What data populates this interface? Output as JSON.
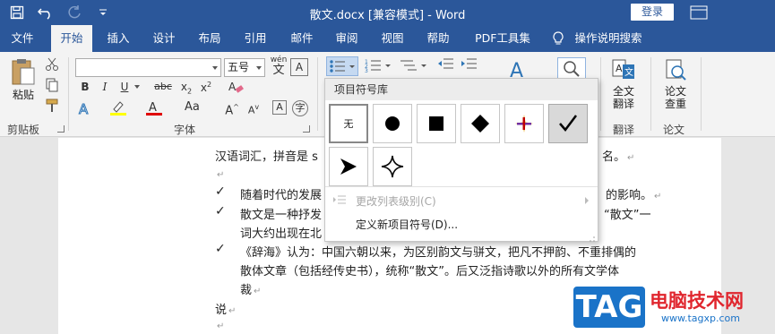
{
  "titlebar": {
    "title": "散文.docx [兼容模式]  -  Word",
    "login_label": "登录"
  },
  "tabs": [
    {
      "label": "文件"
    },
    {
      "label": "开始"
    },
    {
      "label": "插入"
    },
    {
      "label": "设计"
    },
    {
      "label": "布局"
    },
    {
      "label": "引用"
    },
    {
      "label": "邮件"
    },
    {
      "label": "审阅"
    },
    {
      "label": "视图"
    },
    {
      "label": "帮助"
    },
    {
      "label": "PDF工具集"
    },
    {
      "label": "操作说明搜索"
    }
  ],
  "ribbon": {
    "paste_label": "粘贴",
    "clipboard_group": "剪贴板",
    "font_group": "字体",
    "font_size_value": "五号",
    "pinyin_label": "wén",
    "translate_label": "全文\n翻译",
    "translate_group": "翻译",
    "paper_check_label": "论文\n查重",
    "paper_group": "论文"
  },
  "document": {
    "line1": "汉语词汇，拼音是 s",
    "line1_end": "名。",
    "items": [
      {
        "text": "随着时代的发展",
        "tail": "的影响。"
      },
      {
        "text": "散文是一种抒发",
        "tail": "“散文”一"
      },
      {
        "text": "词大约出现在北",
        "tail": ""
      },
      {
        "text": "《辞海》认为：中国六朝以来，为区别韵文与骈文，把凡不押韵、不重排偶的",
        "tail": ""
      },
      {
        "text": "散体文章（包括经传史书），统称“散文”。后又泛指诗歌以外的所有文学体",
        "tail": ""
      },
      {
        "text": "裁",
        "tail": ""
      }
    ],
    "last_line": "说"
  },
  "bullet_dropdown": {
    "title": "项目符号库",
    "none_label": "无",
    "change_level": "更改列表级别(C)",
    "define_new": "定义新项目符号(D)..."
  },
  "watermark": {
    "tag": "TAG",
    "title": "电脑技术网",
    "url": "www.tagxp.com"
  }
}
